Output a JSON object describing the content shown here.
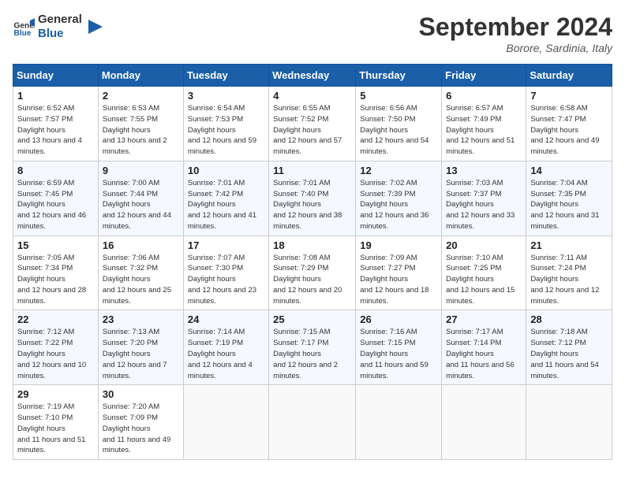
{
  "header": {
    "logo_line1": "General",
    "logo_line2": "Blue",
    "month": "September 2024",
    "location": "Borore, Sardinia, Italy"
  },
  "weekdays": [
    "Sunday",
    "Monday",
    "Tuesday",
    "Wednesday",
    "Thursday",
    "Friday",
    "Saturday"
  ],
  "weeks": [
    [
      {
        "day": "1",
        "sunrise": "6:52 AM",
        "sunset": "7:57 PM",
        "daylight": "13 hours and 4 minutes."
      },
      {
        "day": "2",
        "sunrise": "6:53 AM",
        "sunset": "7:55 PM",
        "daylight": "13 hours and 2 minutes."
      },
      {
        "day": "3",
        "sunrise": "6:54 AM",
        "sunset": "7:53 PM",
        "daylight": "12 hours and 59 minutes."
      },
      {
        "day": "4",
        "sunrise": "6:55 AM",
        "sunset": "7:52 PM",
        "daylight": "12 hours and 57 minutes."
      },
      {
        "day": "5",
        "sunrise": "6:56 AM",
        "sunset": "7:50 PM",
        "daylight": "12 hours and 54 minutes."
      },
      {
        "day": "6",
        "sunrise": "6:57 AM",
        "sunset": "7:49 PM",
        "daylight": "12 hours and 51 minutes."
      },
      {
        "day": "7",
        "sunrise": "6:58 AM",
        "sunset": "7:47 PM",
        "daylight": "12 hours and 49 minutes."
      }
    ],
    [
      {
        "day": "8",
        "sunrise": "6:59 AM",
        "sunset": "7:45 PM",
        "daylight": "12 hours and 46 minutes."
      },
      {
        "day": "9",
        "sunrise": "7:00 AM",
        "sunset": "7:44 PM",
        "daylight": "12 hours and 44 minutes."
      },
      {
        "day": "10",
        "sunrise": "7:01 AM",
        "sunset": "7:42 PM",
        "daylight": "12 hours and 41 minutes."
      },
      {
        "day": "11",
        "sunrise": "7:01 AM",
        "sunset": "7:40 PM",
        "daylight": "12 hours and 38 minutes."
      },
      {
        "day": "12",
        "sunrise": "7:02 AM",
        "sunset": "7:39 PM",
        "daylight": "12 hours and 36 minutes."
      },
      {
        "day": "13",
        "sunrise": "7:03 AM",
        "sunset": "7:37 PM",
        "daylight": "12 hours and 33 minutes."
      },
      {
        "day": "14",
        "sunrise": "7:04 AM",
        "sunset": "7:35 PM",
        "daylight": "12 hours and 31 minutes."
      }
    ],
    [
      {
        "day": "15",
        "sunrise": "7:05 AM",
        "sunset": "7:34 PM",
        "daylight": "12 hours and 28 minutes."
      },
      {
        "day": "16",
        "sunrise": "7:06 AM",
        "sunset": "7:32 PM",
        "daylight": "12 hours and 25 minutes."
      },
      {
        "day": "17",
        "sunrise": "7:07 AM",
        "sunset": "7:30 PM",
        "daylight": "12 hours and 23 minutes."
      },
      {
        "day": "18",
        "sunrise": "7:08 AM",
        "sunset": "7:29 PM",
        "daylight": "12 hours and 20 minutes."
      },
      {
        "day": "19",
        "sunrise": "7:09 AM",
        "sunset": "7:27 PM",
        "daylight": "12 hours and 18 minutes."
      },
      {
        "day": "20",
        "sunrise": "7:10 AM",
        "sunset": "7:25 PM",
        "daylight": "12 hours and 15 minutes."
      },
      {
        "day": "21",
        "sunrise": "7:11 AM",
        "sunset": "7:24 PM",
        "daylight": "12 hours and 12 minutes."
      }
    ],
    [
      {
        "day": "22",
        "sunrise": "7:12 AM",
        "sunset": "7:22 PM",
        "daylight": "12 hours and 10 minutes."
      },
      {
        "day": "23",
        "sunrise": "7:13 AM",
        "sunset": "7:20 PM",
        "daylight": "12 hours and 7 minutes."
      },
      {
        "day": "24",
        "sunrise": "7:14 AM",
        "sunset": "7:19 PM",
        "daylight": "12 hours and 4 minutes."
      },
      {
        "day": "25",
        "sunrise": "7:15 AM",
        "sunset": "7:17 PM",
        "daylight": "12 hours and 2 minutes."
      },
      {
        "day": "26",
        "sunrise": "7:16 AM",
        "sunset": "7:15 PM",
        "daylight": "11 hours and 59 minutes."
      },
      {
        "day": "27",
        "sunrise": "7:17 AM",
        "sunset": "7:14 PM",
        "daylight": "11 hours and 56 minutes."
      },
      {
        "day": "28",
        "sunrise": "7:18 AM",
        "sunset": "7:12 PM",
        "daylight": "11 hours and 54 minutes."
      }
    ],
    [
      {
        "day": "29",
        "sunrise": "7:19 AM",
        "sunset": "7:10 PM",
        "daylight": "11 hours and 51 minutes."
      },
      {
        "day": "30",
        "sunrise": "7:20 AM",
        "sunset": "7:09 PM",
        "daylight": "11 hours and 49 minutes."
      },
      null,
      null,
      null,
      null,
      null
    ]
  ]
}
